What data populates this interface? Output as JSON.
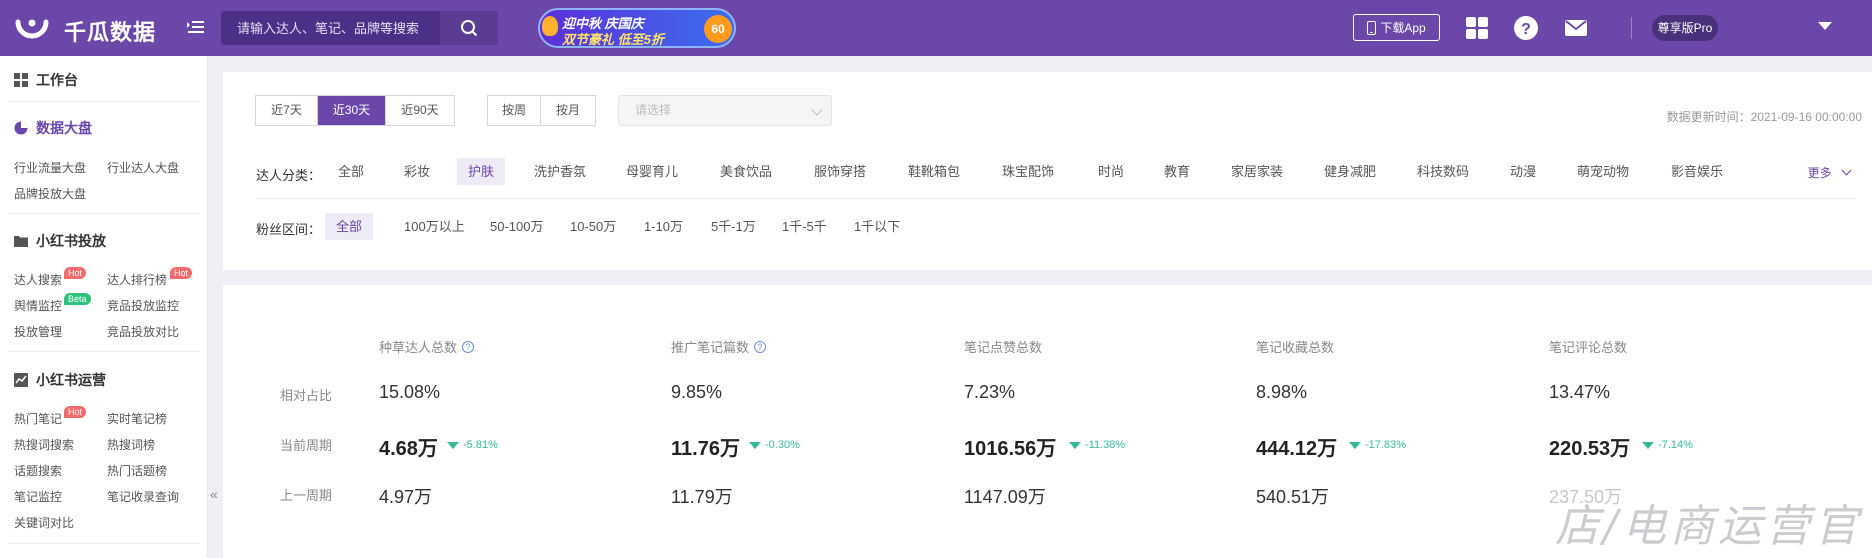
{
  "brand": {
    "name": "千瓜数据"
  },
  "search": {
    "placeholder": "请输入达人、笔记、品牌等搜索"
  },
  "promo": {
    "line1": "迎中秋 庆国庆",
    "line2": "双节豪礼 低至5折",
    "badge": "60"
  },
  "header": {
    "download": "下载App",
    "vip": "尊享版Pro"
  },
  "sidebar": {
    "workbench": "工作台",
    "dashboard": {
      "title": "数据大盘",
      "items": [
        "行业流量大盘",
        "行业达人大盘",
        "品牌投放大盘"
      ]
    },
    "xhs_ads": {
      "title": "小红书投放",
      "items": [
        "达人搜索",
        "达人排行榜",
        "舆情监控",
        "竞品投放监控",
        "投放管理",
        "竞品投放对比"
      ]
    },
    "xhs_ops": {
      "title": "小红书运营",
      "items": [
        "热门笔记",
        "实时笔记榜",
        "热搜词搜索",
        "热搜词榜",
        "话题搜索",
        "热门话题榜",
        "笔记监控",
        "笔记收录查询",
        "关键词对比"
      ]
    },
    "tags": {
      "hot": "Hot",
      "beta": "Beta"
    },
    "collapse": "«"
  },
  "filters": {
    "periods": [
      "近7天",
      "近30天",
      "近90天"
    ],
    "granularity": [
      "按周",
      "按月"
    ],
    "select_placeholder": "请选择",
    "update_time": "数据更新时间：2021-09-16 00:00:00",
    "category_label": "达人分类：",
    "categories": [
      "全部",
      "彩妆",
      "护肤",
      "洗护香氛",
      "母婴育儿",
      "美食饮品",
      "服饰穿搭",
      "鞋靴箱包",
      "珠宝配饰",
      "时尚",
      "教育",
      "家居家装",
      "健身减肥",
      "科技数码",
      "动漫",
      "萌宠动物",
      "影音娱乐"
    ],
    "more": "更多",
    "fans_label": "粉丝区间：",
    "fans": [
      "全部",
      "100万以上",
      "50-100万",
      "10-50万",
      "1-10万",
      "5千-1万",
      "1千-5千",
      "1千以下"
    ]
  },
  "stats": {
    "row_labels": [
      "相对占比",
      "当前周期",
      "上一周期"
    ],
    "columns": [
      {
        "title": "种草达人总数",
        "ratio": "15.08%",
        "current": "4.68万",
        "delta": "-5.81%",
        "previous": "4.97万"
      },
      {
        "title": "推广笔记篇数",
        "ratio": "9.85%",
        "current": "11.76万",
        "delta": "-0.30%",
        "previous": "11.79万"
      },
      {
        "title": "笔记点赞总数",
        "ratio": "7.23%",
        "current": "1016.56万",
        "delta": "-11.38%",
        "previous": "1147.09万"
      },
      {
        "title": "笔记收藏总数",
        "ratio": "8.98%",
        "current": "444.12万",
        "delta": "-17.83%",
        "previous": "540.51万"
      },
      {
        "title": "笔记评论总数",
        "ratio": "13.47%",
        "current": "220.53万",
        "delta": "-7.14%",
        "previous": "237.50万"
      }
    ],
    "watermark": "店/电商运营官"
  },
  "colors": {
    "primary": "#6a47a8",
    "down": "#36b89a",
    "hot": "#f56a6a",
    "beta": "#2fc27a"
  }
}
